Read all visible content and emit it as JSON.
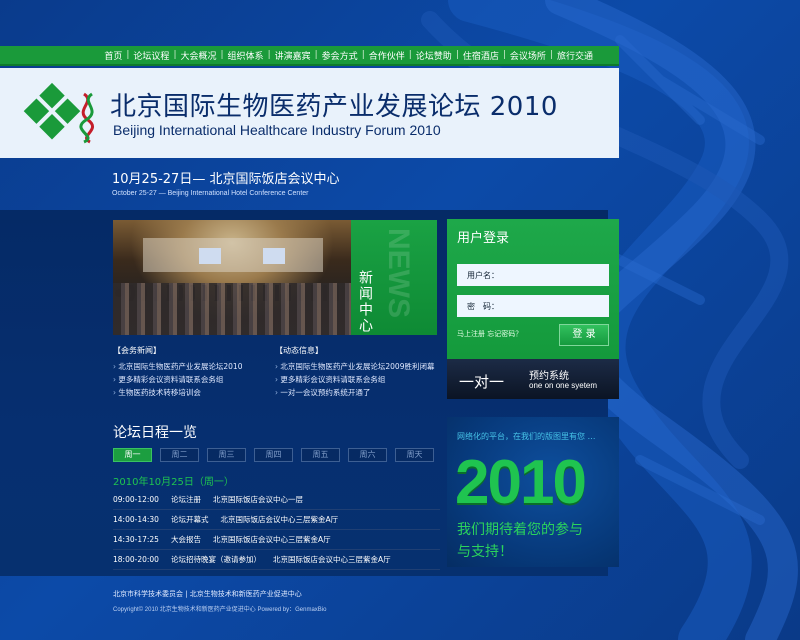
{
  "nav": {
    "items": [
      "首页",
      "论坛议程",
      "大会概况",
      "组织体系",
      "讲演嘉宾",
      "参会方式",
      "合作伙伴",
      "论坛赞助",
      "住宿酒店",
      "会议场所",
      "旅行交通"
    ]
  },
  "banner": {
    "title_cn": "北京国际生物医药产业发展论坛  2010",
    "title_en": "Beijing International Healthcare Industry Forum 2010"
  },
  "event": {
    "date_cn": "10月25-27日— 北京国际饭店会议中心",
    "date_en": "October 25-27 — Beijing International Hotel Conference Center"
  },
  "news": {
    "tab_label": "新闻中心",
    "tab_ghost": "NEWS",
    "left": {
      "head": "【会务新闻】",
      "items": [
        "北京国际生物医药产业发展论坛2010",
        "更多精彩会议资料请联系会务组",
        "生物医药技术转移培训会"
      ]
    },
    "right": {
      "head": "【动态信息】",
      "items": [
        "北京国际生物医药产业发展论坛2009胜利闭幕",
        "更多精彩会议资料请联系会务组",
        "一对一会议预约系统开通了"
      ]
    }
  },
  "login": {
    "title": "用户登录",
    "username_label": "用户名：",
    "password_label": "密　码：",
    "links": "马上注册  忘记密码？",
    "submit": "登 录"
  },
  "one_on_one": {
    "big": "一对一",
    "cn": "预约系统",
    "en": "one on one syetem"
  },
  "promo": {
    "tagline": "网络化的平台，在我们的版图里有您 …",
    "year": "2010",
    "line1": "我们期待着您的参与",
    "line2": "与支持！"
  },
  "schedule": {
    "title": "论坛日程一览",
    "days": [
      "周一",
      "周二",
      "周三",
      "周四",
      "周五",
      "周六",
      "周天"
    ],
    "active_day": 0,
    "date": "2010年10月25日（周一）",
    "rows": [
      {
        "time": "09:00-12:00",
        "activity": "论坛注册",
        "place": "北京国际饭店会议中心一层"
      },
      {
        "time": "14:00-14:30",
        "activity": "论坛开幕式",
        "place": "北京国际饭店会议中心三层紫金A厅"
      },
      {
        "time": "14:30-17:25",
        "activity": "大会报告",
        "place": "北京国际饭店会议中心三层紫金A厅"
      },
      {
        "time": "18:00-20:00",
        "activity": "论坛招待晚宴（邀请参加）",
        "place": "北京国际饭店会议中心三层紫金A厅"
      }
    ]
  },
  "footer": {
    "orgs": "北京市科学技术委员会 | 北京生物技术和新医药产业促进中心",
    "copyright": "Copyright© 2010 北京生物技术和新医药产业促进中心 Powered by：GenmaxBio"
  },
  "colors": {
    "bg_blue": "#0c4aa8",
    "brand_green": "#1a9a3a",
    "title_navy": "#0a2d6b",
    "accent_green_text": "#1fc450"
  }
}
